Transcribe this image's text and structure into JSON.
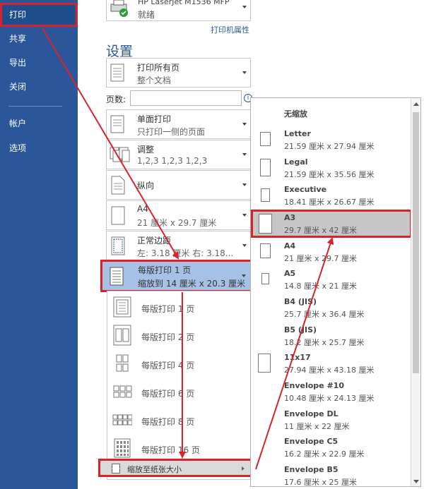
{
  "nav": {
    "items": [
      {
        "label": "打印",
        "active": true
      },
      {
        "label": "共享"
      },
      {
        "label": "导出"
      },
      {
        "label": "关闭"
      },
      {
        "label": "帐户"
      },
      {
        "label": "选项"
      }
    ]
  },
  "printer": {
    "name": "HP LaserJet M1536 MFP",
    "status": "就绪",
    "properties_link": "打印机属性"
  },
  "settings": {
    "title": "设置",
    "pages_label": "页数:",
    "pages_value": "",
    "rows": {
      "print_range": {
        "line1": "打印所有页",
        "line2": "整个文档"
      },
      "sides": {
        "line1": "单面打印",
        "line2": "只打印一侧的页面"
      },
      "collate": {
        "line1": "调整",
        "line2": "1,2,3    1,2,3    1,2,3"
      },
      "orientation": {
        "line1": "纵向"
      },
      "paper": {
        "line1": "A4",
        "line2": "21 厘米 x 29.7 厘米"
      },
      "margins": {
        "line1": "正常边距",
        "line2": "左: 3.18 厘米    右: 3.18..."
      },
      "pages_per_sheet": {
        "line1": "每版打印 1 页",
        "line2": "缩放到 14 厘米 x 20.3 厘米"
      }
    }
  },
  "pages_per_sheet_menu": {
    "items": [
      {
        "label": "每版打印 1 页"
      },
      {
        "label": "每版打印 2 页"
      },
      {
        "label": "每版打印 4 页"
      },
      {
        "label": "每版打印 6 页"
      },
      {
        "label": "每版打印 8 页"
      },
      {
        "label": "每版打印 16 页"
      }
    ],
    "fit_to_paper": "缩放至纸张大小"
  },
  "paper_sizes": {
    "no_scale": "无缩放",
    "items": [
      {
        "name": "Letter",
        "dims": "21.59 厘米 x 27.94 厘米"
      },
      {
        "name": "Legal",
        "dims": "21.59 厘米 x 35.56 厘米"
      },
      {
        "name": "Executive",
        "dims": "18.41 厘米 x 26.67 厘米"
      },
      {
        "name": "A3",
        "dims": "29.7 厘米 x 42 厘米",
        "selected": true
      },
      {
        "name": "A4",
        "dims": "21 厘米 x 29.7 厘米"
      },
      {
        "name": "A5",
        "dims": "14.8 厘米 x 21 厘米"
      },
      {
        "name": "B4 (JIS)",
        "dims": "25.7 厘米 x 36.4 厘米"
      },
      {
        "name": "B5 (JIS)",
        "dims": "18.2 厘米 x 25.7 厘米"
      },
      {
        "name": "11x17",
        "dims": "27.94 厘米 x 43.18 厘米"
      },
      {
        "name": "Envelope #10",
        "dims": "10.48 厘米 x 24.13 厘米"
      },
      {
        "name": "Envelope DL",
        "dims": "11 厘米 x 22 厘米"
      },
      {
        "name": "Envelope C5",
        "dims": "16.2 厘米 x 22.9 厘米"
      },
      {
        "name": "Envelope B5",
        "dims": "17.6 厘米 x 25 厘米"
      }
    ]
  },
  "colors": {
    "nav_bg": "#2b579a",
    "highlight_red": "#d9232b",
    "selected_blue": "#a7c0e6"
  }
}
